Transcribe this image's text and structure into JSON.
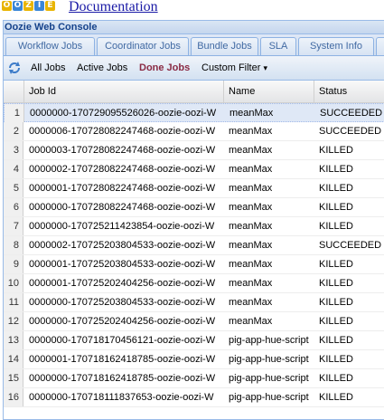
{
  "header": {
    "logo_letters": [
      "O",
      "O",
      "Z",
      "I",
      "E"
    ],
    "logo_colors": [
      "#e8b400",
      "#3a86d8",
      "#e8b400",
      "#3a86d8",
      "#e8b400"
    ],
    "doc_link": "Documentation"
  },
  "panel": {
    "title": "Oozie Web Console"
  },
  "tabs": [
    {
      "label": "Workflow Jobs",
      "active": true
    },
    {
      "label": "Coordinator Jobs",
      "active": false
    },
    {
      "label": "Bundle Jobs",
      "active": false
    },
    {
      "label": "SLA",
      "active": false
    },
    {
      "label": "System Info",
      "active": false
    }
  ],
  "toolbar": {
    "refresh_icon": "refresh-icon",
    "all_jobs": "All Jobs",
    "active_jobs": "Active Jobs",
    "done_jobs": "Done Jobs",
    "custom_filter": "Custom Filter",
    "custom_filter_arrow": "▾"
  },
  "grid": {
    "columns": [
      "Job Id",
      "Name",
      "Status"
    ],
    "rows": [
      {
        "n": "1",
        "id": "0000000-170729095526026-oozie-oozi-W",
        "name": "meanMax",
        "status": "SUCCEEDED"
      },
      {
        "n": "2",
        "id": "0000006-170728082247468-oozie-oozi-W",
        "name": "meanMax",
        "status": "SUCCEEDED"
      },
      {
        "n": "3",
        "id": "0000003-170728082247468-oozie-oozi-W",
        "name": "meanMax",
        "status": "KILLED"
      },
      {
        "n": "4",
        "id": "0000002-170728082247468-oozie-oozi-W",
        "name": "meanMax",
        "status": "KILLED"
      },
      {
        "n": "5",
        "id": "0000001-170728082247468-oozie-oozi-W",
        "name": "meanMax",
        "status": "KILLED"
      },
      {
        "n": "6",
        "id": "0000000-170728082247468-oozie-oozi-W",
        "name": "meanMax",
        "status": "KILLED"
      },
      {
        "n": "7",
        "id": "0000000-170725211423854-oozie-oozi-W",
        "name": "meanMax",
        "status": "KILLED"
      },
      {
        "n": "8",
        "id": "0000002-170725203804533-oozie-oozi-W",
        "name": "meanMax",
        "status": "SUCCEEDED"
      },
      {
        "n": "9",
        "id": "0000001-170725203804533-oozie-oozi-W",
        "name": "meanMax",
        "status": "KILLED"
      },
      {
        "n": "10",
        "id": "0000001-170725202404256-oozie-oozi-W",
        "name": "meanMax",
        "status": "KILLED"
      },
      {
        "n": "11",
        "id": "0000000-170725203804533-oozie-oozi-W",
        "name": "meanMax",
        "status": "KILLED"
      },
      {
        "n": "12",
        "id": "0000000-170725202404256-oozie-oozi-W",
        "name": "meanMax",
        "status": "KILLED"
      },
      {
        "n": "13",
        "id": "0000000-170718170456121-oozie-oozi-W",
        "name": "pig-app-hue-script",
        "status": "KILLED"
      },
      {
        "n": "14",
        "id": "0000001-170718162418785-oozie-oozi-W",
        "name": "pig-app-hue-script",
        "status": "KILLED"
      },
      {
        "n": "15",
        "id": "0000000-170718162418785-oozie-oozi-W",
        "name": "pig-app-hue-script",
        "status": "KILLED"
      },
      {
        "n": "16",
        "id": "0000000-170718111837653-oozie-oozi-W",
        "name": "pig-app-hue-script",
        "status": "KILLED"
      }
    ]
  }
}
